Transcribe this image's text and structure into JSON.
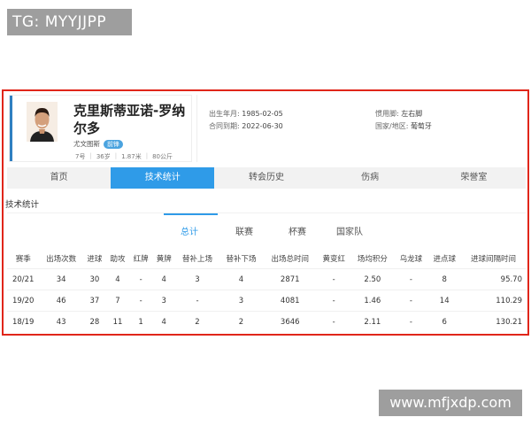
{
  "watermark_top": "TG: MYYJJPP",
  "watermark_bottom": "www.mfjxdp.com",
  "player": {
    "name": "克里斯蒂亚诺-罗纳尔多",
    "team": "尤文图斯",
    "position": "前锋",
    "number": "7号",
    "age": "36岁",
    "height": "1.87米",
    "weight": "80公斤"
  },
  "info": {
    "birth_label": "出生年月:",
    "birth_value": "1985-02-05",
    "contract_label": "合同到期:",
    "contract_value": "2022-06-30",
    "foot_label": "惯用脚:",
    "foot_value": "左右脚",
    "nation_label": "国家/地区:",
    "nation_value": "葡萄牙"
  },
  "tabs": [
    "首页",
    "技术统计",
    "转会历史",
    "伤病",
    "荣誉室"
  ],
  "active_tab": 1,
  "section_title": "技术统计",
  "subtabs": [
    "总计",
    "联赛",
    "杯赛",
    "国家队"
  ],
  "active_subtab": 0,
  "table": {
    "headers": [
      "赛季",
      "出场次数",
      "进球",
      "助攻",
      "红牌",
      "黄牌",
      "替补上场",
      "替补下场",
      "出场总时间",
      "黄变红",
      "场均积分",
      "乌龙球",
      "进点球",
      "进球间隔时间"
    ],
    "rows": [
      [
        "20/21",
        "34",
        "30",
        "4",
        "-",
        "4",
        "3",
        "4",
        "2871",
        "-",
        "2.50",
        "-",
        "8",
        "95.70"
      ],
      [
        "19/20",
        "46",
        "37",
        "7",
        "-",
        "3",
        "-",
        "3",
        "4081",
        "-",
        "1.46",
        "-",
        "14",
        "110.29"
      ],
      [
        "18/19",
        "43",
        "28",
        "11",
        "1",
        "4",
        "2",
        "2",
        "3646",
        "-",
        "2.11",
        "-",
        "6",
        "130.21"
      ]
    ]
  },
  "colors": {
    "accent": "#2f9be8",
    "highlight_border": "#e0261a"
  }
}
